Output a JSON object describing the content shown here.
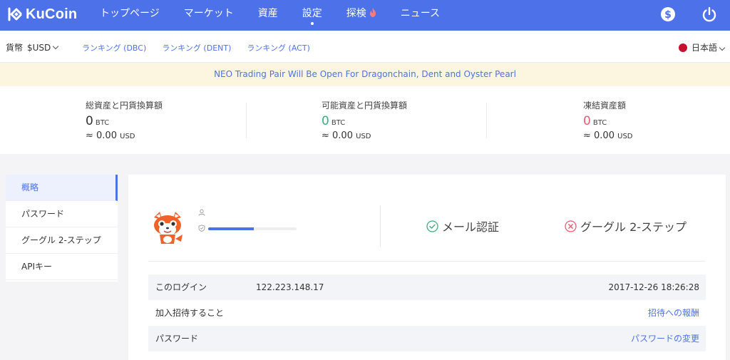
{
  "brand": {
    "name": "KuCoin"
  },
  "nav": {
    "items": [
      {
        "label": "トップページ"
      },
      {
        "label": "マーケット"
      },
      {
        "label": "資産"
      },
      {
        "label": "設定"
      },
      {
        "label": "探検"
      },
      {
        "label": "ニュース"
      }
    ],
    "active_index": 3,
    "right_icons": [
      "dollar-icon",
      "power-icon"
    ]
  },
  "subbar": {
    "currency_label": "貨幣",
    "currency_value": "$USD",
    "rank_links": [
      "ランキング (DBC)",
      "ランキング (DENT)",
      "ランキング (ACT)"
    ],
    "language": "日本語"
  },
  "banner": {
    "text": "NEO Trading Pair Will Be Open For Dragonchain, Dent and Oyster Pearl"
  },
  "assets": [
    {
      "label": "総資産と円貨換算額",
      "amount": "0",
      "unit": "BTC",
      "usd_prefix": "≈ 0.00",
      "usd_unit": "USD",
      "color": "#333333"
    },
    {
      "label": "可能資産と円貨換算額",
      "amount": "0",
      "unit": "BTC",
      "usd_prefix": "≈ 0.00",
      "usd_unit": "USD",
      "color": "#3cad7f"
    },
    {
      "label": "凍結資産額",
      "amount": "0",
      "unit": "BTC",
      "usd_prefix": "≈ 0.00",
      "usd_unit": "USD",
      "color": "#ef5a6f"
    }
  ],
  "sidebar": {
    "items": [
      {
        "label": "概略"
      },
      {
        "label": "パスワード"
      },
      {
        "label": "グーグル 2-ステップ"
      },
      {
        "label": "APIキー"
      }
    ],
    "active_index": 0
  },
  "profile": {
    "security_level": 0.52,
    "email_verify": {
      "label": "メール認証",
      "icon": "check-circle-icon",
      "color": "#3cad7f"
    },
    "google_verify": {
      "label": "グーグル 2-ステップ",
      "icon": "x-circle-icon",
      "color": "#ef5a6f"
    }
  },
  "info_rows": [
    {
      "key": "このログイン",
      "middle": "122.223.148.17",
      "right": "2017-12-26 18:26:28",
      "right_is_link": false
    },
    {
      "key": "加入招待すること",
      "middle": "",
      "right": "招待への報酬",
      "right_is_link": true
    },
    {
      "key": "パスワード",
      "middle": "",
      "right": "パスワードの変更",
      "right_is_link": true
    }
  ]
}
